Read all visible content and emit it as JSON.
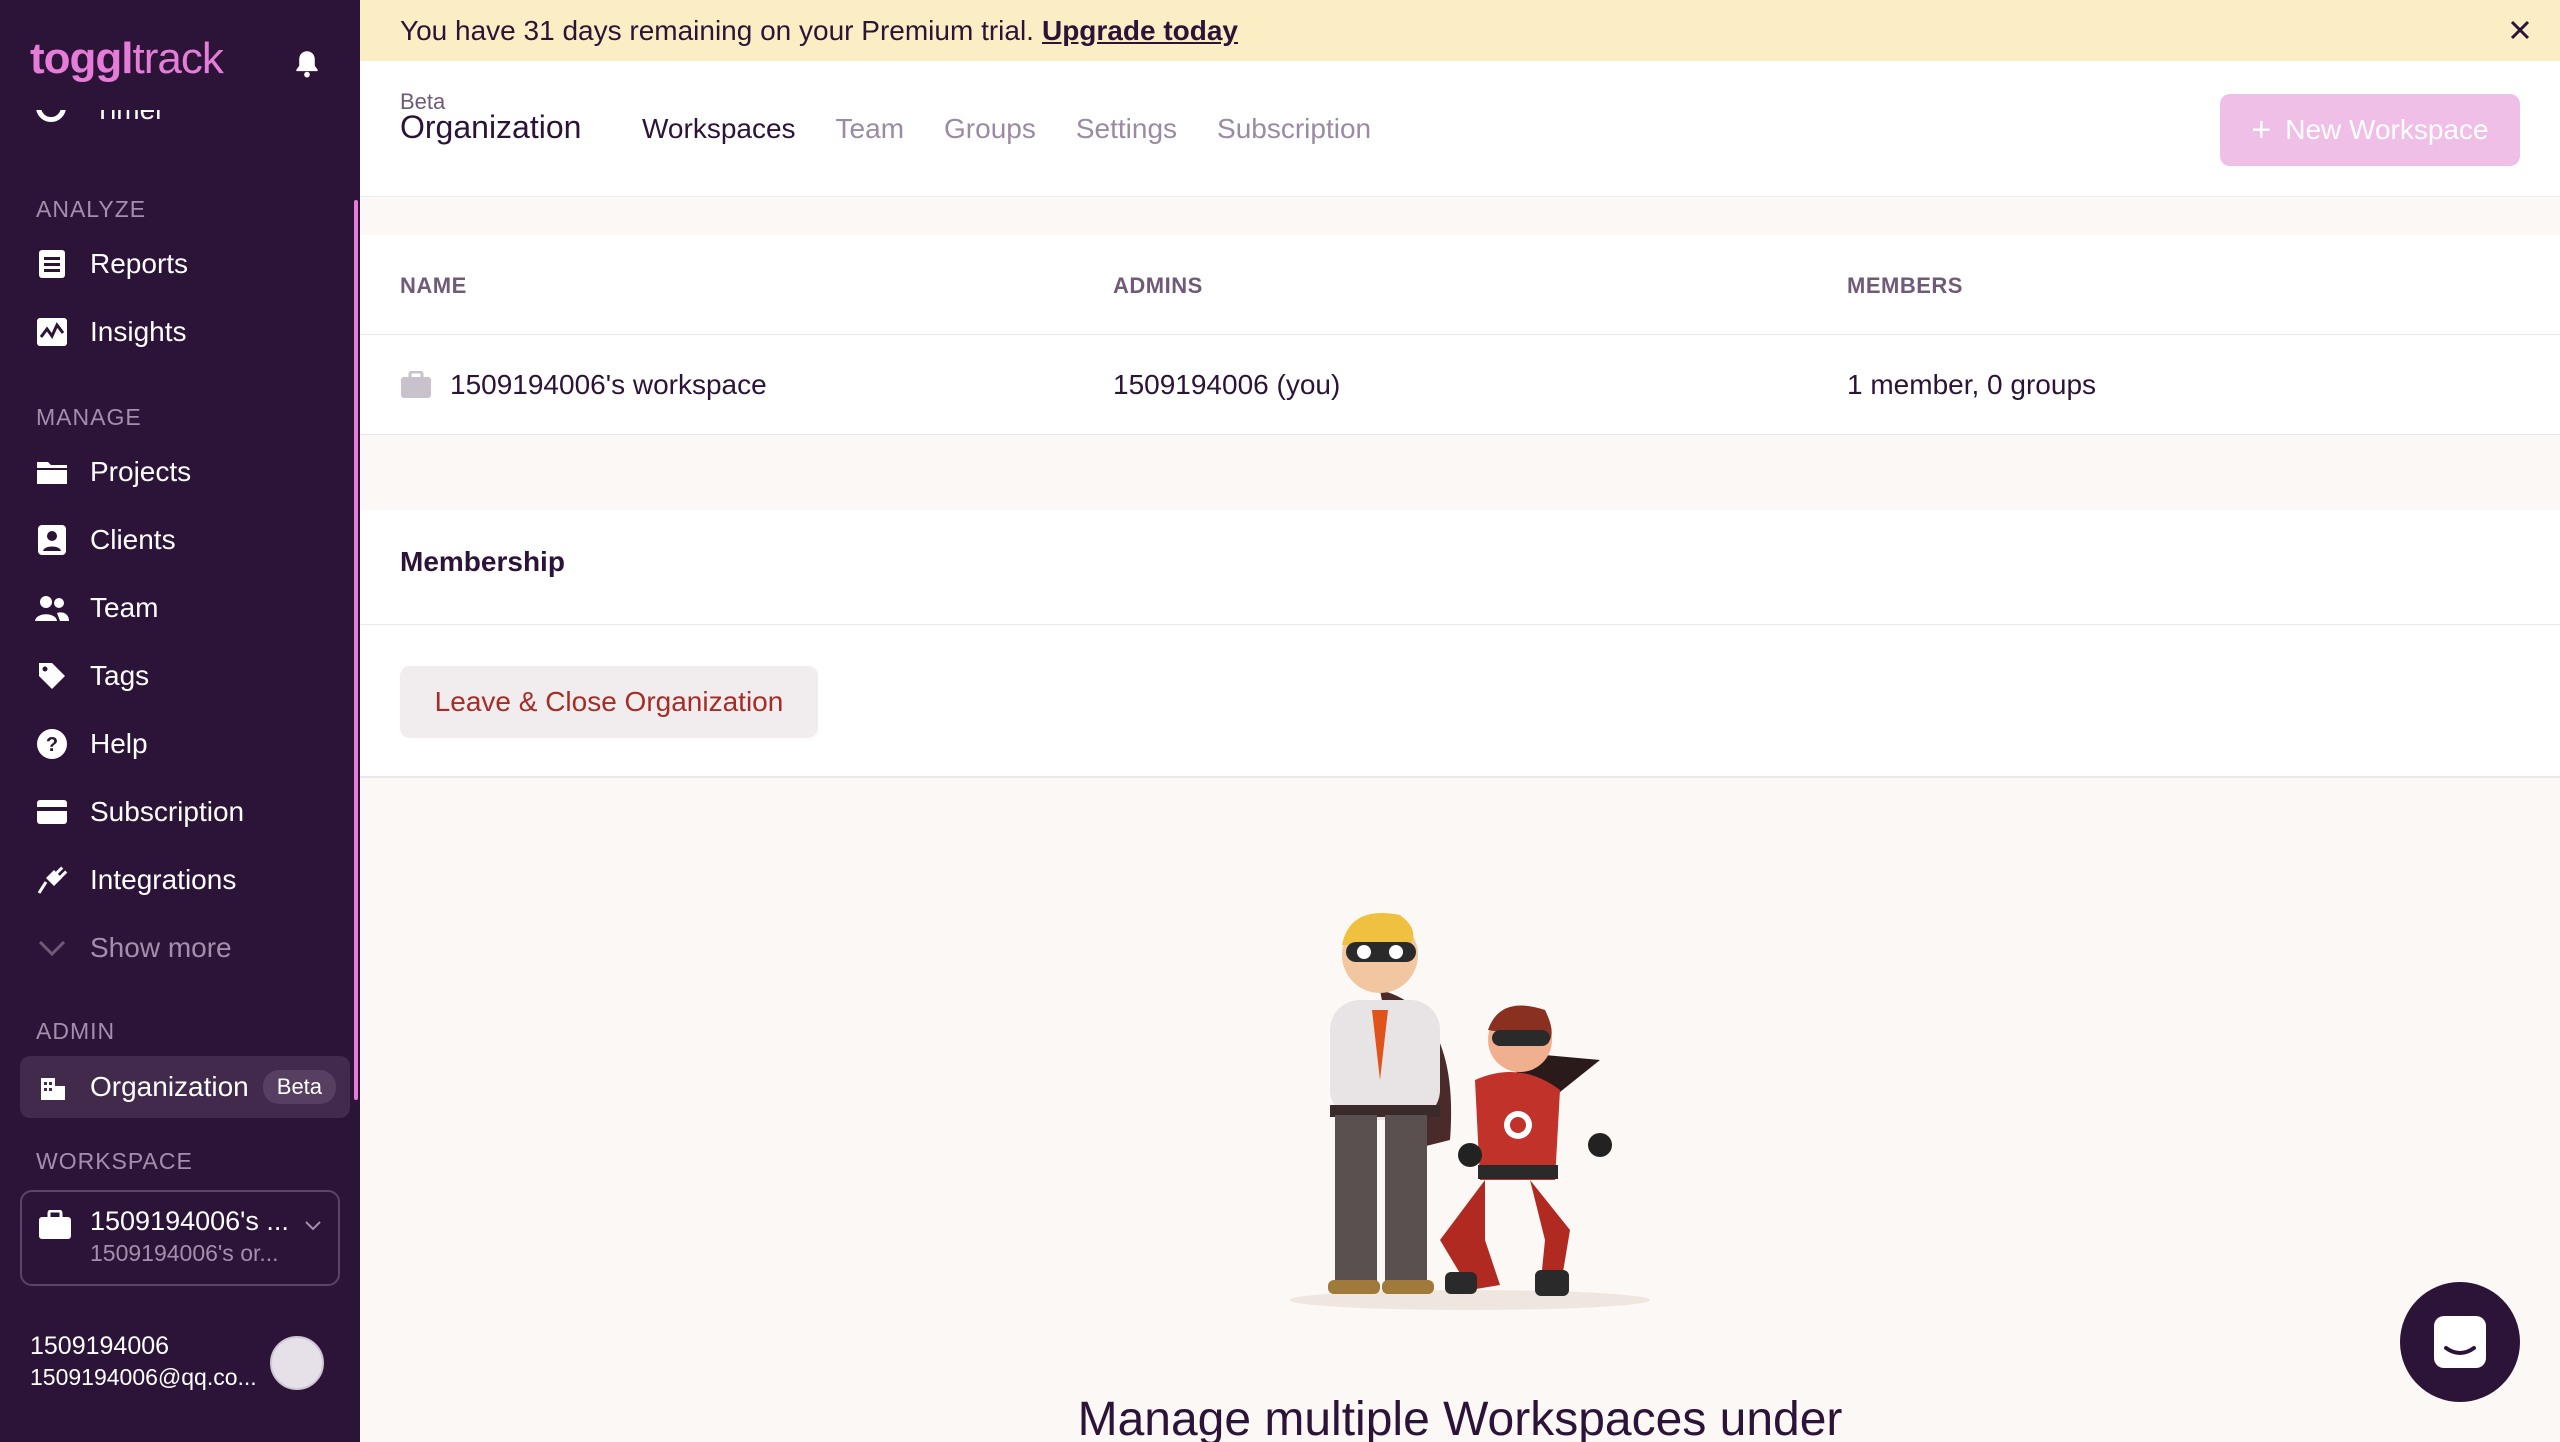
{
  "banner": {
    "message": "You have 31 days remaining on your Premium trial.",
    "link": "Upgrade today"
  },
  "sidebar": {
    "logo_bold": "toggl",
    "logo_light": "track",
    "timer_label": "Timer",
    "sections": {
      "analyze": "ANALYZE",
      "manage": "MANAGE",
      "admin": "ADMIN",
      "workspace": "WORKSPACE"
    },
    "items": {
      "reports": "Reports",
      "insights": "Insights",
      "projects": "Projects",
      "clients": "Clients",
      "team": "Team",
      "tags": "Tags",
      "help": "Help",
      "subscription": "Subscription",
      "integrations": "Integrations",
      "show_more": "Show more",
      "organization": "Organization",
      "organization_badge": "Beta"
    },
    "workspace": {
      "name": "1509194006's ...",
      "org": "1509194006's or..."
    },
    "user": {
      "name": "1509194006",
      "email": "1509194006@qq.co..."
    }
  },
  "header": {
    "beta": "Beta",
    "title": "Organization",
    "tabs": [
      "Workspaces",
      "Team",
      "Groups",
      "Settings",
      "Subscription"
    ],
    "active_tab": "Workspaces",
    "new_workspace": "New Workspace"
  },
  "table": {
    "columns": [
      "NAME",
      "ADMINS",
      "MEMBERS"
    ],
    "rows": [
      {
        "name": "1509194006's workspace",
        "admins": "1509194006 (you)",
        "members": "1 member, 0 groups"
      }
    ]
  },
  "membership": {
    "title": "Membership",
    "leave_button": "Leave & Close Organization"
  },
  "empty_state": {
    "heading": "Manage multiple Workspaces under"
  },
  "colors": {
    "sidebar_bg": "#2c1338",
    "accent": "#e57cd8",
    "banner_bg": "#fbeec5",
    "danger_text": "#a52d25"
  }
}
